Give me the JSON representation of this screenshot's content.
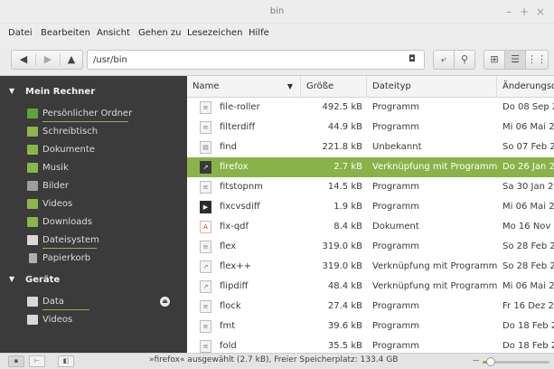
{
  "window": {
    "title": "bin",
    "minimize": "–",
    "maximize": "+",
    "close": "×"
  },
  "menu": [
    "Datei",
    "Bearbeiten",
    "Ansicht",
    "Gehen zu",
    "Lesezeichen",
    "Hilfe"
  ],
  "toolbar": {
    "back": "◀",
    "forward": "▶",
    "up": "▲",
    "location": "/usr/bin",
    "location_icon": "◘",
    "path_toggle": "⤶",
    "search": "⚲",
    "view_icons": "⊞",
    "view_list": "☰",
    "view_compact": "⋮⋮"
  },
  "sidebar": {
    "sections": [
      {
        "title": "Mein Rechner",
        "items": [
          {
            "label": "Persönlicher Ordner",
            "icon": "home-folder-icon",
            "color": "#5fa33c"
          },
          {
            "label": "Schreibtisch",
            "icon": "desktop-folder-icon",
            "color": "#8ab64c"
          },
          {
            "label": "Dokumente",
            "icon": "documents-folder-icon",
            "color": "#8ab64c"
          },
          {
            "label": "Musik",
            "icon": "music-folder-icon",
            "color": "#8ab64c"
          },
          {
            "label": "Bilder",
            "icon": "pictures-folder-icon",
            "color": "#9aa0a0"
          },
          {
            "label": "Videos",
            "icon": "videos-folder-icon",
            "color": "#8ab64c"
          },
          {
            "label": "Downloads",
            "icon": "downloads-folder-icon",
            "color": "#8ab64c"
          },
          {
            "label": "Dateisystem",
            "icon": "drive-icon",
            "color": "#d8d8d8"
          },
          {
            "label": "Papierkorb",
            "icon": "trash-icon",
            "color": "#b0b0b0"
          }
        ]
      },
      {
        "title": "Geräte",
        "items": [
          {
            "label": "Data",
            "icon": "drive-icon",
            "color": "#d8d8d8"
          },
          {
            "label": "Videos",
            "icon": "drive-icon",
            "color": "#d8d8d8"
          }
        ]
      }
    ]
  },
  "columns": {
    "name": "Name",
    "size": "Größe",
    "type": "Dateityp",
    "date": "Änderungsdatum"
  },
  "files": [
    {
      "name": "file-roller",
      "size": "492.5 kB",
      "type": "Programm",
      "date": "Do 08 Sep 2",
      "icon": "executable-icon"
    },
    {
      "name": "filterdiff",
      "size": "44.9 kB",
      "type": "Programm",
      "date": "Mi 06 Mai 2",
      "icon": "executable-icon"
    },
    {
      "name": "find",
      "size": "221.8 kB",
      "type": "Unbekannt",
      "date": "So 07 Feb 2",
      "icon": "unknown-file-icon"
    },
    {
      "name": "firefox",
      "size": "2.7 kB",
      "type": "Verknüpfung mit Programm",
      "date": "Do 26 Jan 2",
      "icon": "link-icon",
      "selected": true
    },
    {
      "name": "fitstopnm",
      "size": "14.5 kB",
      "type": "Programm",
      "date": "Sa 30 Jan 20",
      "icon": "executable-icon"
    },
    {
      "name": "fixcvsdiff",
      "size": "1.9 kB",
      "type": "Programm",
      "date": "Mi 06 Mai 2",
      "icon": "script-icon"
    },
    {
      "name": "fix-qdf",
      "size": "8.4 kB",
      "type": "Dokument",
      "date": "Mo 16 Nov",
      "icon": "pdf-icon"
    },
    {
      "name": "flex",
      "size": "319.0 kB",
      "type": "Programm",
      "date": "So 28 Feb 2",
      "icon": "executable-icon"
    },
    {
      "name": "flex++",
      "size": "319.0 kB",
      "type": "Verknüpfung mit Programm",
      "date": "So 28 Feb 2",
      "icon": "link-icon"
    },
    {
      "name": "flipdiff",
      "size": "48.4 kB",
      "type": "Verknüpfung mit Programm",
      "date": "Mi 06 Mai 2",
      "icon": "link-icon"
    },
    {
      "name": "flock",
      "size": "27.4 kB",
      "type": "Programm",
      "date": "Fr 16 Dez 2",
      "icon": "executable-icon"
    },
    {
      "name": "fmt",
      "size": "39.6 kB",
      "type": "Programm",
      "date": "Do 18 Feb 2",
      "icon": "executable-icon"
    },
    {
      "name": "fold",
      "size": "35.5 kB",
      "type": "Programm",
      "date": "Do 18 Feb 2",
      "icon": "executable-icon"
    }
  ],
  "status": {
    "text": "»firefox« ausgewählt (2.7 kB), Freier Speicherplatz: 133.4 GB",
    "zoom_fraction": 0.12
  },
  "colors": {
    "accent": "#89b34a",
    "sidebar_bg": "#3b3b3b"
  }
}
